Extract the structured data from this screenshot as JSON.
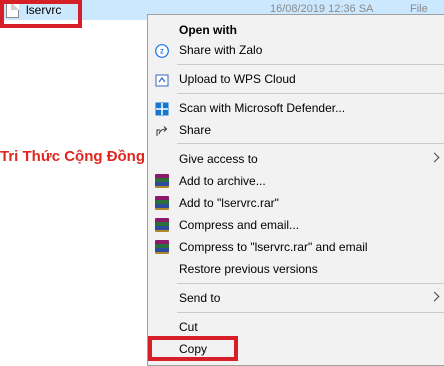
{
  "explorer": {
    "file_name": "lservrc",
    "file_date": "16/08/2019 12:36 SA",
    "file_type": "File"
  },
  "watermark": "Tri Thức Cộng Đồng",
  "menu": {
    "open_with": "Open with",
    "share_zalo": "Share with Zalo",
    "upload_wps": "Upload to WPS Cloud",
    "scan_defender": "Scan with Microsoft Defender...",
    "share": "Share",
    "give_access": "Give access to",
    "add_archive": "Add to archive...",
    "add_rar": "Add to \"lservrc.rar\"",
    "compress_email": "Compress and email...",
    "compress_rar_email": "Compress to \"lservrc.rar\" and email",
    "restore": "Restore previous versions",
    "send_to": "Send to",
    "cut": "Cut",
    "copy": "Copy"
  },
  "colors": {
    "highlight": "#d61f26",
    "watermark": "#e0261d",
    "selection": "#cce8ff",
    "menu_bg": "#f2f2f2"
  }
}
